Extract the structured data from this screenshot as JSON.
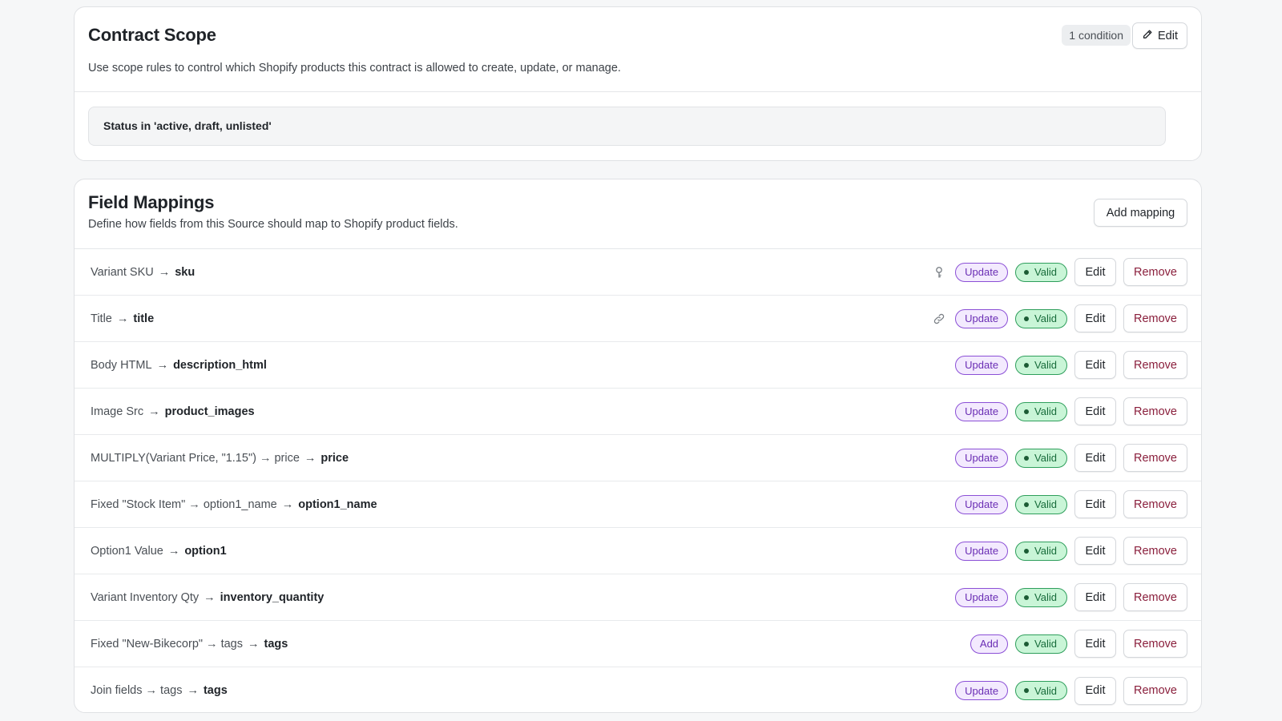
{
  "scope": {
    "title": "Contract Scope",
    "description": "Use scope rules to control which Shopify products this contract is allowed to create, update, or manage.",
    "condition_count": "1 condition",
    "edit_label": "Edit",
    "condition": "Status in 'active, draft, unlisted'"
  },
  "mappings": {
    "title": "Field Mappings",
    "description": "Define how fields from this Source should map to Shopify product fields.",
    "add_label": "Add mapping",
    "arrow": "→",
    "edit_label": "Edit",
    "remove_label": "Remove",
    "valid_label": "Valid",
    "rows": [
      {
        "source": "Variant SKU",
        "target": "sku",
        "action": "Update",
        "icon": "key-icon"
      },
      {
        "source": "Title",
        "target": "title",
        "action": "Update",
        "icon": "link-icon"
      },
      {
        "source": "Body HTML",
        "target": "description_html",
        "action": "Update",
        "icon": ""
      },
      {
        "source": "Image Src",
        "target": "product_images",
        "action": "Update",
        "icon": ""
      },
      {
        "source": "MULTIPLY(Variant Price, \"1.15\") → price",
        "target": "price",
        "action": "Update",
        "icon": ""
      },
      {
        "source": "Fixed \"Stock Item\" → option1_name",
        "target": "option1_name",
        "action": "Update",
        "icon": ""
      },
      {
        "source": "Option1 Value",
        "target": "option1",
        "action": "Update",
        "icon": ""
      },
      {
        "source": "Variant Inventory Qty",
        "target": "inventory_quantity",
        "action": "Update",
        "icon": ""
      },
      {
        "source": "Fixed \"New-Bikecorp\" → tags",
        "target": "tags",
        "action": "Add",
        "icon": ""
      },
      {
        "source": "Join fields → tags",
        "target": "tags",
        "action": "Update",
        "icon": ""
      }
    ]
  },
  "colors": {
    "update_pill": "#8b4fd6",
    "valid_pill": "#2e9e5b",
    "remove_text": "#8a1f3c"
  }
}
